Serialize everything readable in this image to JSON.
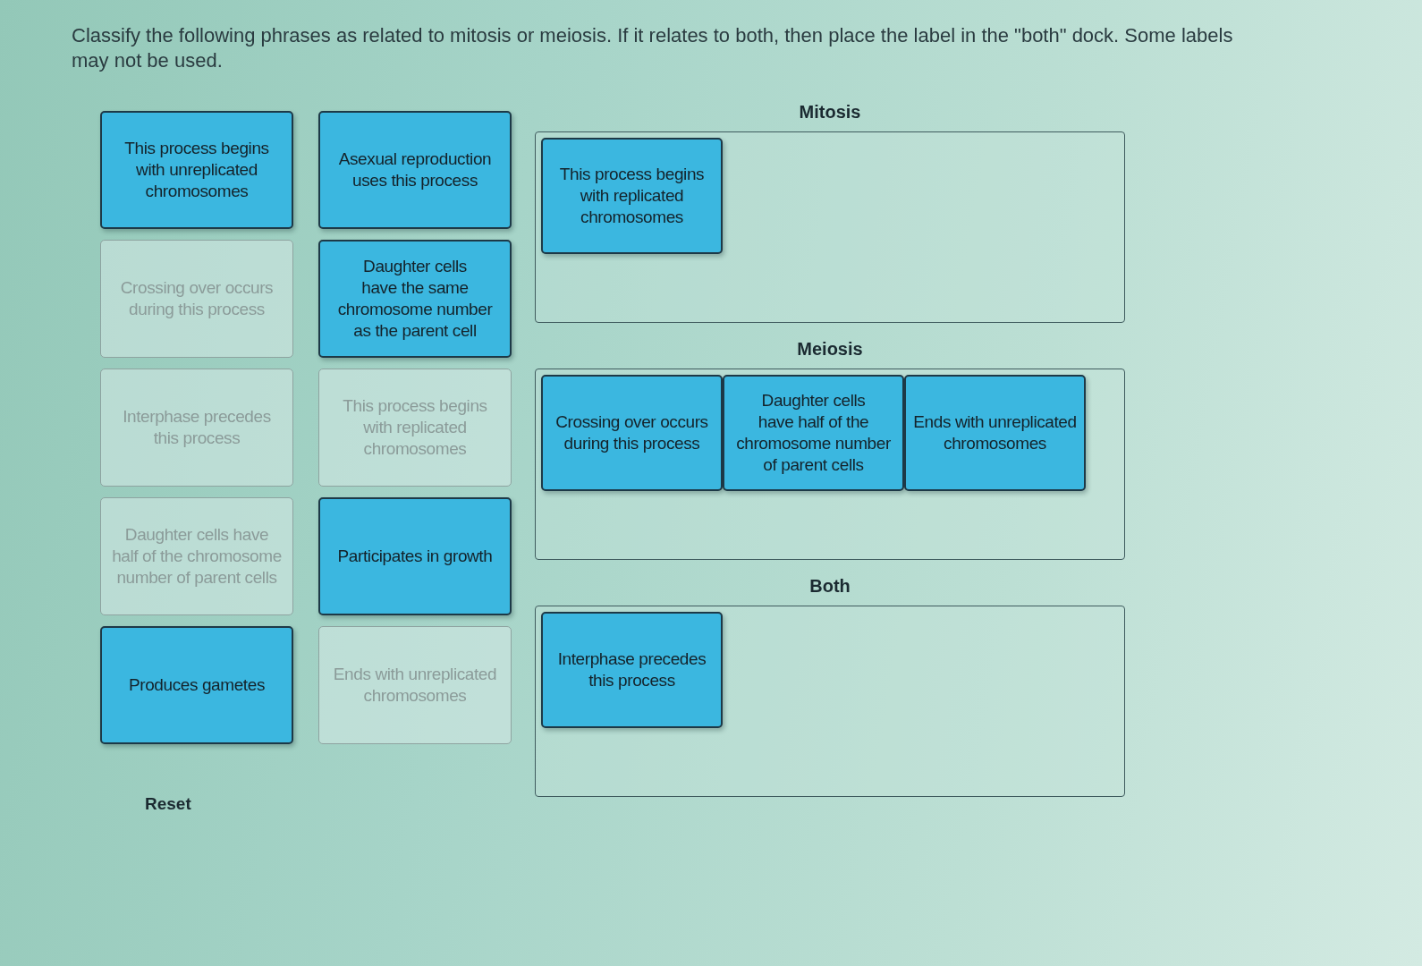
{
  "instructions": "Classify the following phrases as related to mitosis or meiosis. If it relates to both, then place the label in the \"both\" dock. Some labels may not be used.",
  "label_bank": [
    {
      "text": "This process begins with unreplicated chromosomes",
      "placed": false
    },
    {
      "text": "Asexual reproduction uses this process",
      "placed": false
    },
    {
      "text": "Crossing over occurs during this process",
      "placed": true
    },
    {
      "text": "Daughter cells have the same chromosome number as the parent cell",
      "placed": false
    },
    {
      "text": "Interphase precedes this process",
      "placed": true
    },
    {
      "text": "This process begins with replicated chromosomes",
      "placed": true
    },
    {
      "text": "Daughter cells have half of the chromosome number of parent cells",
      "placed": true
    },
    {
      "text": "Participates in growth",
      "placed": false
    },
    {
      "text": "Produces gametes",
      "placed": false
    },
    {
      "text": "Ends with unreplicated chromosomes",
      "placed": true
    }
  ],
  "docks": [
    {
      "title": "Mitosis",
      "labels": [
        "This process begins with replicated chromosomes"
      ]
    },
    {
      "title": "Meiosis",
      "labels": [
        "Crossing over occurs during this process",
        "Daughter cells have half of the chromosome number of parent cells",
        "Ends with unreplicated chromosomes"
      ]
    },
    {
      "title": "Both",
      "labels": [
        "Interphase precedes this process"
      ]
    }
  ],
  "reset_button": "Reset"
}
